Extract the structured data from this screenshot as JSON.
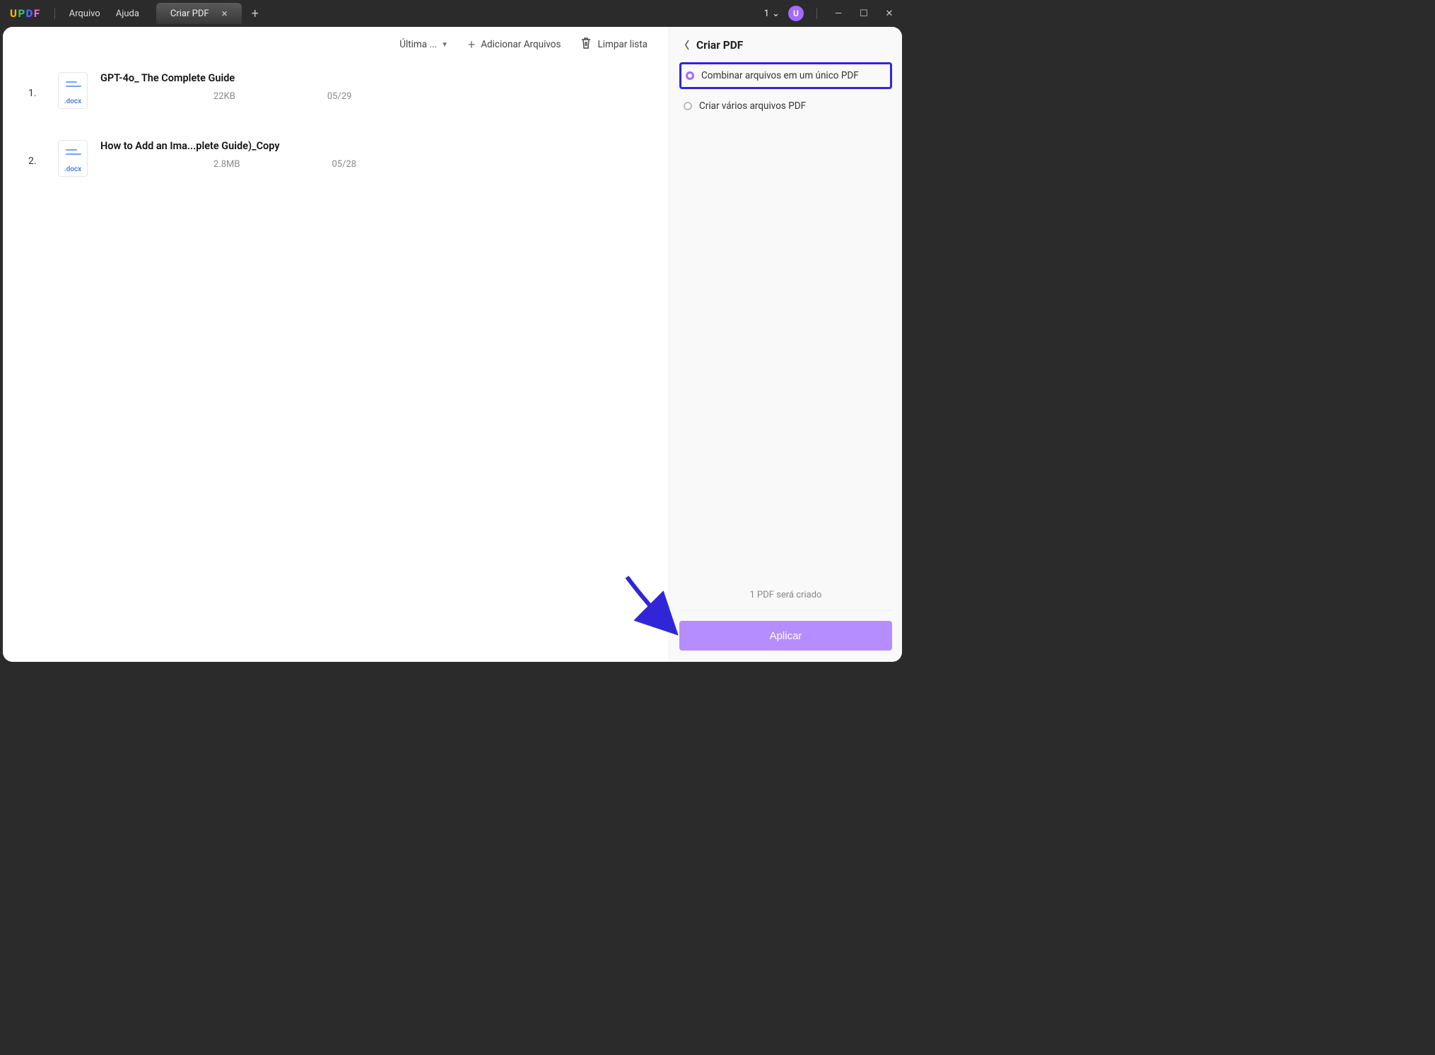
{
  "titlebar": {
    "logo_chars": [
      "U",
      "P",
      "D",
      "F"
    ],
    "menu": {
      "file": "Arquivo",
      "help": "Ajuda"
    },
    "tab": {
      "label": "Criar PDF"
    },
    "account_count": "1",
    "avatar_letter": "U"
  },
  "toolbar": {
    "sort_label": "Última ...",
    "add_files": "Adicionar Arquivos",
    "clear_list": "Limpar lista"
  },
  "files": [
    {
      "num": "1.",
      "name": "GPT-4o_ The Complete Guide",
      "ext": ".docx",
      "size": "22KB",
      "date": "05/29"
    },
    {
      "num": "2.",
      "name": "How to Add an Ima...plete Guide)_Copy",
      "ext": ".docx",
      "size": "2.8MB",
      "date": "05/28"
    }
  ],
  "side": {
    "title": "Criar PDF",
    "options": {
      "combine": "Combinar arquivos em um único PDF",
      "multiple": "Criar vários arquivos PDF"
    },
    "status": "1 PDF será criado",
    "apply": "Aplicar"
  }
}
